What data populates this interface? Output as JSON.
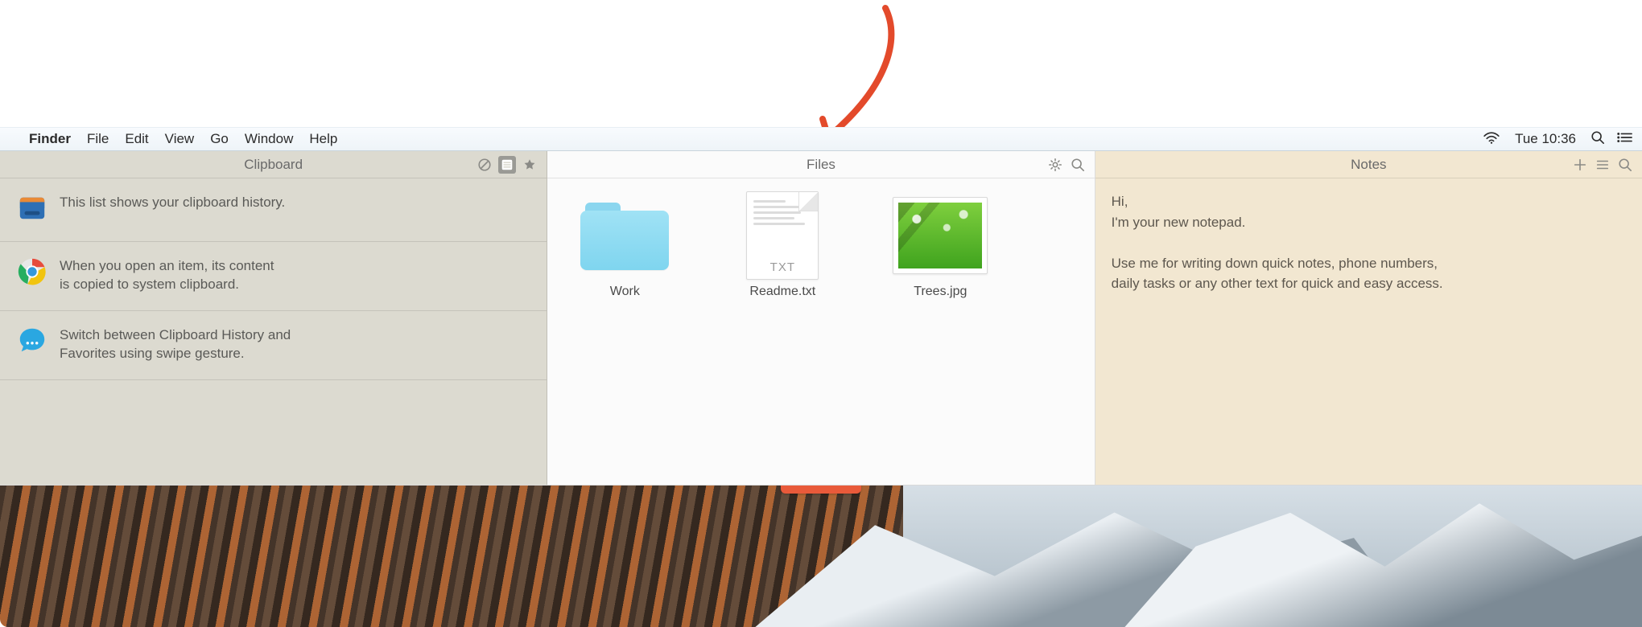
{
  "menubar": {
    "app": "Finder",
    "items": [
      "File",
      "Edit",
      "View",
      "Go",
      "Window",
      "Help"
    ],
    "clock": "Tue 10:36"
  },
  "clipboard": {
    "title": "Clipboard",
    "items": [
      {
        "icon": "wallet",
        "line1": "This list shows your clipboard history.",
        "line2": ""
      },
      {
        "icon": "chrome",
        "line1": "When you open an item, its content",
        "line2": "is copied to system clipboard."
      },
      {
        "icon": "messages",
        "line1": "Switch between Clipboard History and",
        "line2": "Favorites using swipe gesture."
      }
    ]
  },
  "files": {
    "title": "Files",
    "txt_tag": "TXT",
    "items": [
      {
        "kind": "folder",
        "name": "Work"
      },
      {
        "kind": "txt",
        "name": "Readme.txt"
      },
      {
        "kind": "image",
        "name": "Trees.jpg"
      }
    ]
  },
  "notes": {
    "title": "Notes",
    "body": "Hi,\nI'm your new notepad.\n\nUse me for writing down quick notes, phone numbers,\ndaily tasks or any other text for quick and easy access."
  }
}
